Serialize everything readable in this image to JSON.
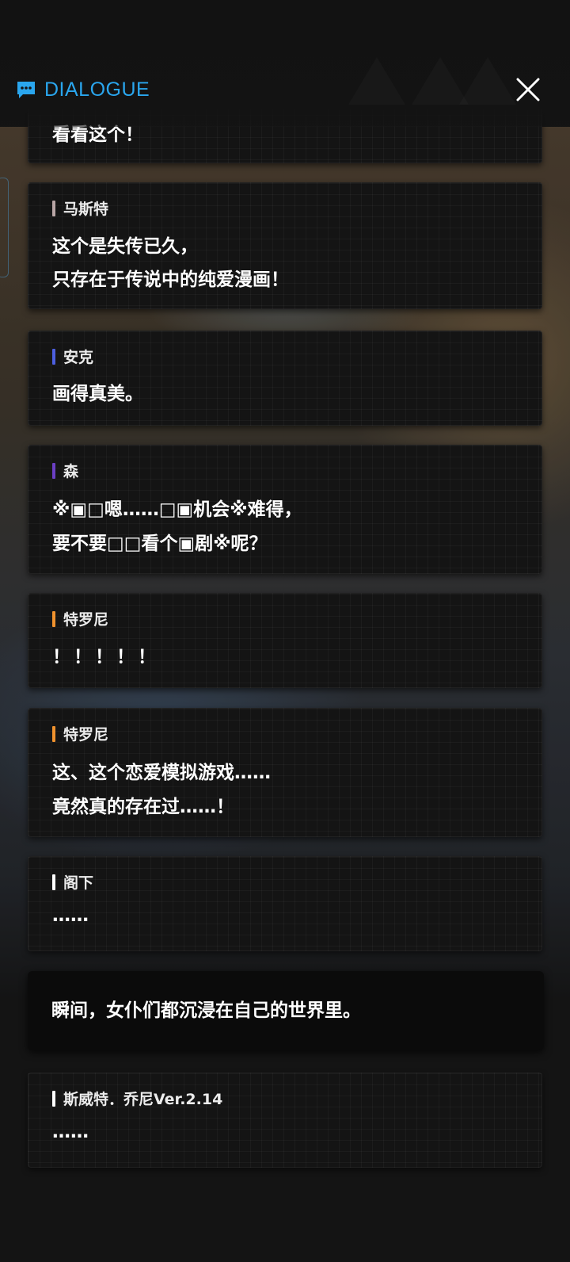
{
  "header": {
    "title": "DIALOGUE",
    "accent_color": "#2aa6ee",
    "title_icon": "chat-bubble-icon",
    "close_icon": "close-icon"
  },
  "dialogue": [
    {
      "speaker": "",
      "lines": [
        "看看这个！"
      ],
      "partial": true
    },
    {
      "speaker": "马斯特",
      "speaker_color": "#b9a6a6",
      "lines": [
        "这个是失传已久，",
        "只存在于传说中的纯爱漫画！"
      ]
    },
    {
      "speaker": "安克",
      "speaker_color": "#4d5fe0",
      "lines": [
        "画得真美。"
      ]
    },
    {
      "speaker": "森",
      "speaker_color": "#6b3fc4",
      "lines": [
        "※▣□嗯……□▣机会※难得，",
        "要不要□□看个▣剧※呢？"
      ]
    },
    {
      "speaker": "特罗尼",
      "speaker_color": "#f0922e",
      "lines": [
        "！！！！！"
      ]
    },
    {
      "speaker": "特罗尼",
      "speaker_color": "#f0922e",
      "lines": [
        "这、这个恋爱模拟游戏……",
        "竟然真的存在过……！"
      ]
    },
    {
      "speaker": "阁下",
      "speaker_color": "#ffffff",
      "lines": [
        "……"
      ]
    },
    {
      "speaker": "",
      "narration": true,
      "lines": [
        "瞬间，女仆们都沉浸在自己的世界里。"
      ]
    },
    {
      "speaker": "斯威特．乔尼Ver.2.14",
      "speaker_color": "#ffffff",
      "lines": [
        "……"
      ]
    }
  ]
}
